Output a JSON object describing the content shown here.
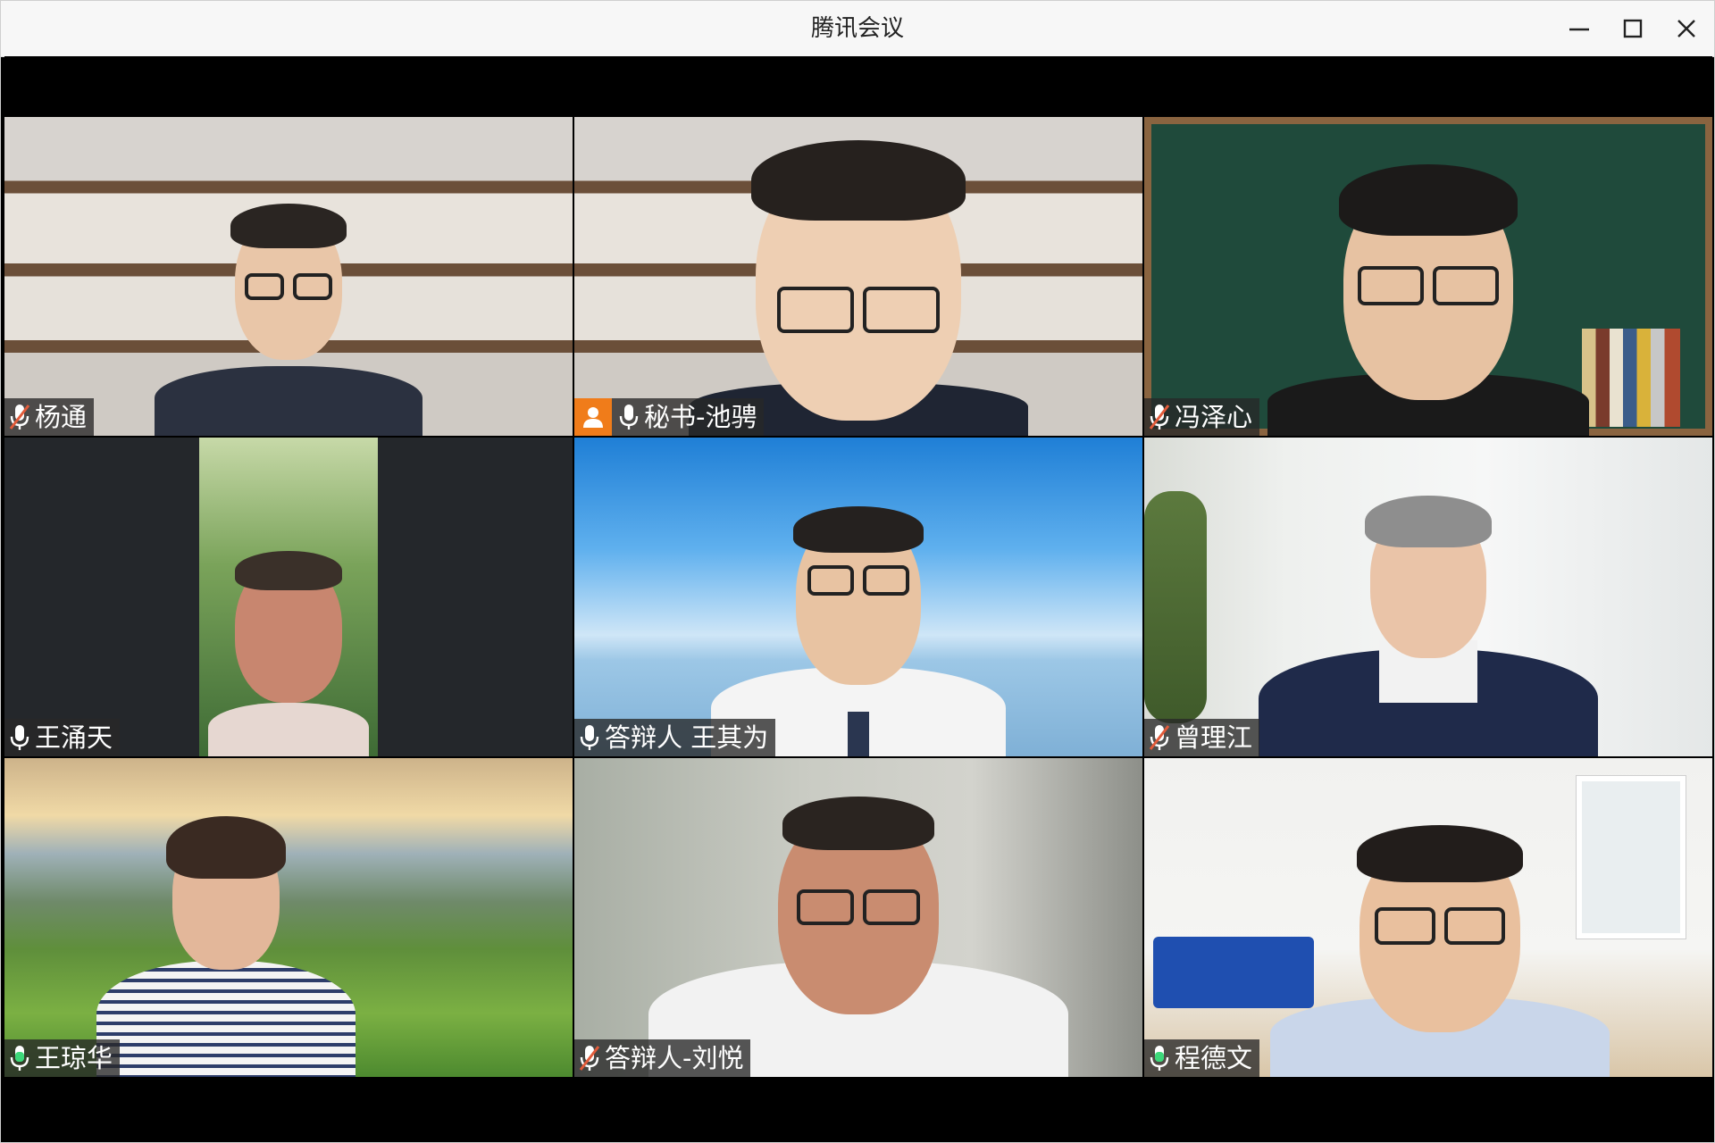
{
  "window": {
    "title": "腾讯会议"
  },
  "participants": [
    {
      "name": "杨通",
      "mic": "muted"
    },
    {
      "name": "秘书-池骋",
      "mic": "on",
      "badge": "host-avatar-icon"
    },
    {
      "name": "冯泽心",
      "mic": "muted"
    },
    {
      "name": "王涌天",
      "mic": "on"
    },
    {
      "name": "答辩人 王其为",
      "mic": "on"
    },
    {
      "name": "曾理江",
      "mic": "muted"
    },
    {
      "name": "王琼华",
      "mic": "speaking"
    },
    {
      "name": "答辩人-刘悦",
      "mic": "muted"
    },
    {
      "name": "程德文",
      "mic": "speaking",
      "active": true
    }
  ],
  "colors": {
    "speaking": "#3dd97a",
    "muted_slash": "#e25b3a",
    "badge": "#f07c1a",
    "active_border": "#2fbf71"
  }
}
